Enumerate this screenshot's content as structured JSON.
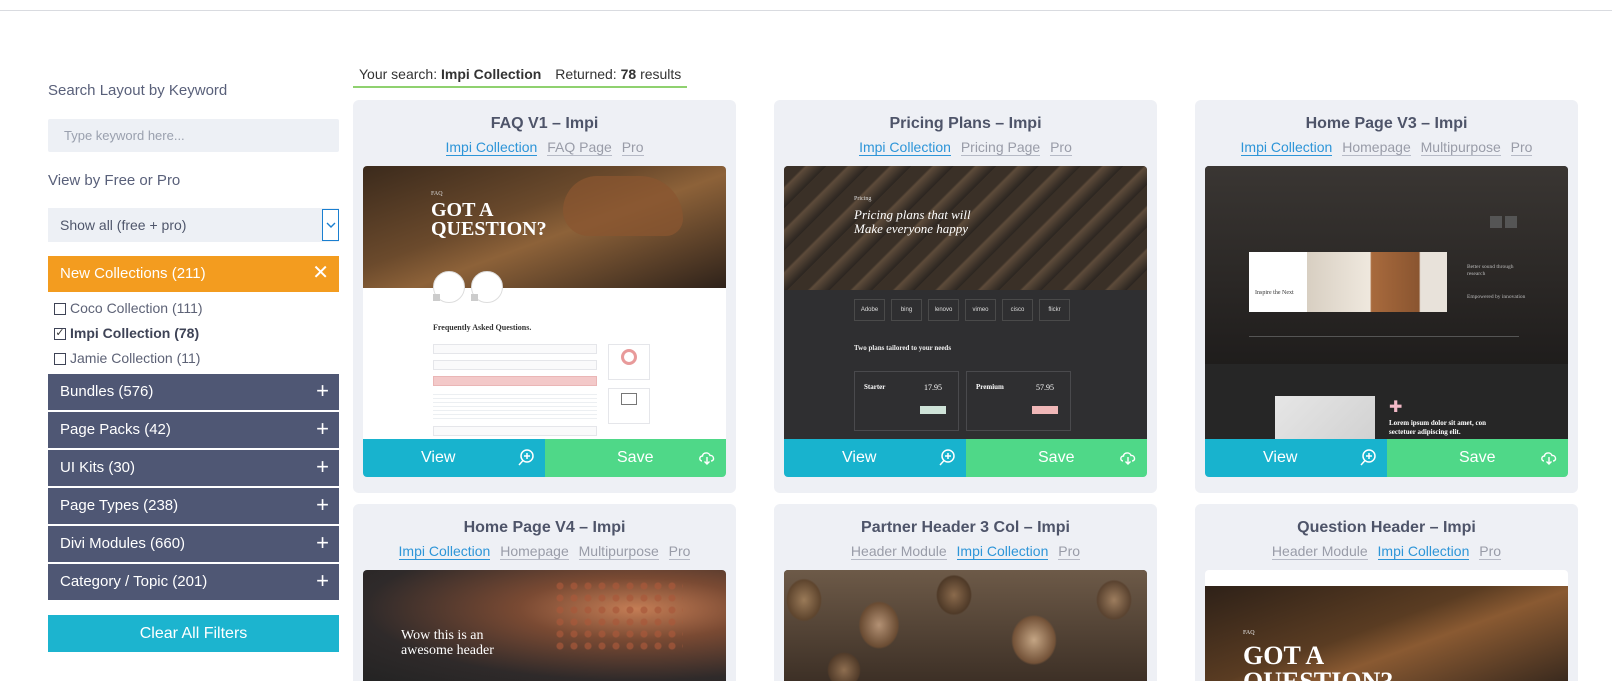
{
  "sidebar": {
    "search_heading": "Search Layout by Keyword",
    "search_placeholder": "Type keyword here...",
    "free_pro_heading": "View by Free or Pro",
    "free_pro_selected": "Show all (free + pro)",
    "groups": [
      {
        "label": "New Collections (211)",
        "state": "expanded",
        "icon": "close-icon",
        "items": [
          {
            "label": "Coco Collection (111)",
            "checked": false
          },
          {
            "label": "Impi Collection (78)",
            "checked": true
          },
          {
            "label": "Jamie Collection (11)",
            "checked": false
          }
        ]
      },
      {
        "label": "Bundles (576)",
        "state": "collapsed",
        "icon": "plus-icon"
      },
      {
        "label": "Page Packs (42)",
        "state": "collapsed",
        "icon": "plus-icon"
      },
      {
        "label": "UI Kits (30)",
        "state": "collapsed",
        "icon": "plus-icon"
      },
      {
        "label": "Page Types (238)",
        "state": "collapsed",
        "icon": "plus-icon"
      },
      {
        "label": "Divi Modules (660)",
        "state": "collapsed",
        "icon": "plus-icon"
      },
      {
        "label": "Category / Topic (201)",
        "state": "collapsed",
        "icon": "plus-icon"
      }
    ],
    "clear_label": "Clear All Filters"
  },
  "results": {
    "search_prefix": "Your search:",
    "search_term": "Impi Collection",
    "returned_prefix": "Returned:",
    "count": "78",
    "count_suffix": "results"
  },
  "cards": [
    {
      "title": "FAQ V1 – Impi",
      "tags": [
        "Impi Collection",
        "FAQ Page",
        "Pro"
      ],
      "highlight": [
        0
      ],
      "thumb": {
        "headline_1": "GOT A",
        "headline_2": "QUESTION?",
        "label": "FAQ",
        "section_title": "Frequently Asked Questions."
      }
    },
    {
      "title": "Pricing Plans – Impi",
      "tags": [
        "Impi Collection",
        "Pricing Page",
        "Pro"
      ],
      "highlight": [
        0
      ],
      "thumb": {
        "headline_1": "Pricing plans that will",
        "headline_2": "Make everyone happy",
        "label": "Pricing",
        "section_title": "Two plans tailored to your needs",
        "plan_1": "Starter",
        "plan_2": "Premium",
        "price_1": "17.95",
        "price_2": "57.95",
        "logos": [
          "Adobe",
          "bing",
          "lenovo",
          "vimeo",
          "cisco",
          "flickr"
        ]
      }
    },
    {
      "title": "Home Page V3 – Impi",
      "tags": [
        "Impi Collection",
        "Homepage",
        "Multipurpose",
        "Pro"
      ],
      "highlight": [
        0
      ],
      "thumb": {
        "caption": "Inspire the Next",
        "side_1": "Better sound through research",
        "side_2": "Empowered by innovation",
        "bottom": "Lorem ipsum dolor sit amet, con sectetuer adipiscing elit."
      }
    },
    {
      "title": "Home Page V4 – Impi",
      "tags": [
        "Impi Collection",
        "Homepage",
        "Multipurpose",
        "Pro"
      ],
      "highlight": [
        0
      ],
      "thumb": {
        "headline_1": "Wow this is an",
        "headline_2": "awesome header"
      }
    },
    {
      "title": "Partner Header 3 Col – Impi",
      "tags": [
        "Header Module",
        "Impi Collection",
        "Pro"
      ],
      "highlight": [
        1
      ],
      "thumb": {}
    },
    {
      "title": "Question Header – Impi",
      "tags": [
        "Header Module",
        "Impi Collection",
        "Pro"
      ],
      "highlight": [
        1
      ],
      "thumb": {
        "label": "FAQ",
        "headline_1": "GOT A",
        "headline_2": "QUESTION?"
      }
    }
  ],
  "buttons": {
    "view": "View",
    "save": "Save"
  },
  "colors": {
    "orange": "#f39c1f",
    "slate": "#4f5774",
    "cyan": "#1cb4cf",
    "green": "#4fd888",
    "link_blue": "#2d95d8"
  }
}
